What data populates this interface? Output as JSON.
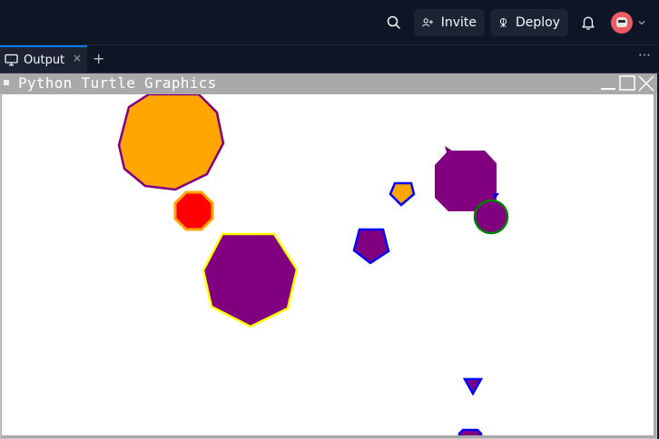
{
  "header": {
    "invite_label": "Invite",
    "deploy_label": "Deploy",
    "icons": [
      "search-icon",
      "add-user-icon",
      "deploy-icon",
      "bell-icon",
      "avatar",
      "chevron-down-icon"
    ]
  },
  "tabs": {
    "output_label": "Output",
    "close_glyph": "×",
    "add_glyph": "+",
    "more_glyph": "⋯"
  },
  "turtle_window": {
    "title": "Python Turtle Graphics",
    "colors": {
      "orange": "#ffa500",
      "purple": "#800080",
      "red": "#ff0000",
      "yellow": "#ffff00",
      "blue": "#0000ff",
      "green": "#008000"
    }
  }
}
